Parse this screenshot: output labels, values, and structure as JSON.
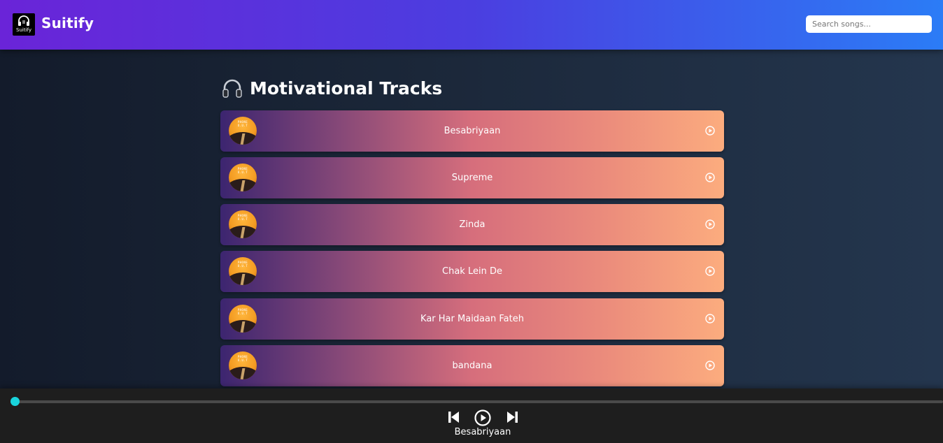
{
  "header": {
    "logo_text": "Suitify",
    "brand": "Suitify",
    "search_placeholder": "Search songs..."
  },
  "section": {
    "title": "Motivational Tracks",
    "icon": "headphones-icon"
  },
  "tracks": [
    {
      "title": "Besabriyaan"
    },
    {
      "title": "Supreme"
    },
    {
      "title": "Zinda"
    },
    {
      "title": "Chak Lein De"
    },
    {
      "title": "Kar Har Maidaan Fateh"
    },
    {
      "title": "bandana"
    }
  ],
  "player": {
    "now_playing": "Besabriyaan",
    "progress": 0,
    "controls": [
      "previous-icon",
      "play-icon",
      "next-icon"
    ]
  },
  "colors": {
    "accent": "#19d4dc",
    "header_start": "#6a24d8",
    "header_end": "#2b7cf6"
  }
}
